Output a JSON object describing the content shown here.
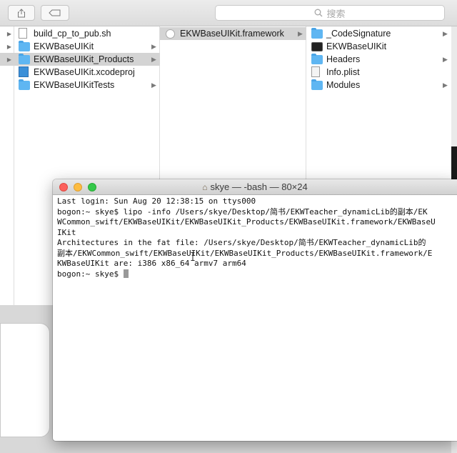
{
  "finder": {
    "search_placeholder": "搜索",
    "columns": [
      {
        "items": [
          {
            "label": "build_cp_to_pub.sh",
            "icon": "document-icon",
            "disclosure": true,
            "chevron": false,
            "selected": false
          },
          {
            "label": "EKWBaseUIKit",
            "icon": "folder-icon",
            "disclosure": true,
            "chevron": true,
            "selected": false
          },
          {
            "label": "EKWBaseUIKit_Products",
            "icon": "folder-icon",
            "disclosure": true,
            "chevron": true,
            "selected": true
          },
          {
            "label": "EKWBaseUIKit.xcodeproj",
            "icon": "xcodeproj-icon",
            "disclosure": false,
            "chevron": false,
            "selected": false
          },
          {
            "label": "EKWBaseUIKitTests",
            "icon": "folder-icon",
            "disclosure": false,
            "chevron": true,
            "selected": false
          }
        ]
      },
      {
        "items": [
          {
            "label": "EKWBaseUIKit.framework",
            "icon": "framework-icon",
            "chevron": true,
            "selected": true
          }
        ]
      },
      {
        "items": [
          {
            "label": "_CodeSignature",
            "icon": "folder-icon",
            "chevron": true
          },
          {
            "label": "EKWBaseUIKit",
            "icon": "executable-icon",
            "chevron": false
          },
          {
            "label": "Headers",
            "icon": "folder-icon",
            "chevron": true
          },
          {
            "label": "Info.plist",
            "icon": "plist-icon",
            "chevron": false
          },
          {
            "label": "Modules",
            "icon": "folder-icon",
            "chevron": true
          }
        ]
      }
    ]
  },
  "terminal": {
    "title": "skye — -bash — 80×24",
    "lines": [
      "Last login: Sun Aug 20 12:38:15 on ttys000",
      "bogon:~ skye$ lipo -info /Users/skye/Desktop/简书/EKWTeacher_dynamicLib的副本/EK",
      "WCommon_swift/EKWBaseUIKit/EKWBaseUIKit_Products/EKWBaseUIKit.framework/EKWBaseU",
      "IKit",
      "Architectures in the fat file: /Users/skye/Desktop/简书/EKWTeacher_dynamicLib的",
      "副本/EKWCommon_swift/EKWBaseUIKit/EKWBaseUIKit_Products/EKWBaseUIKit.framework/E",
      "KWBaseUIKit are: i386 x86_64 armv7 arm64"
    ],
    "prompt": "bogon:~ skye$ "
  },
  "colors": {
    "folder": "#5fb6f2",
    "selection": "#d4d4d4",
    "close": "#fc605b",
    "minimize": "#fdbc40",
    "zoom": "#34c84a"
  }
}
